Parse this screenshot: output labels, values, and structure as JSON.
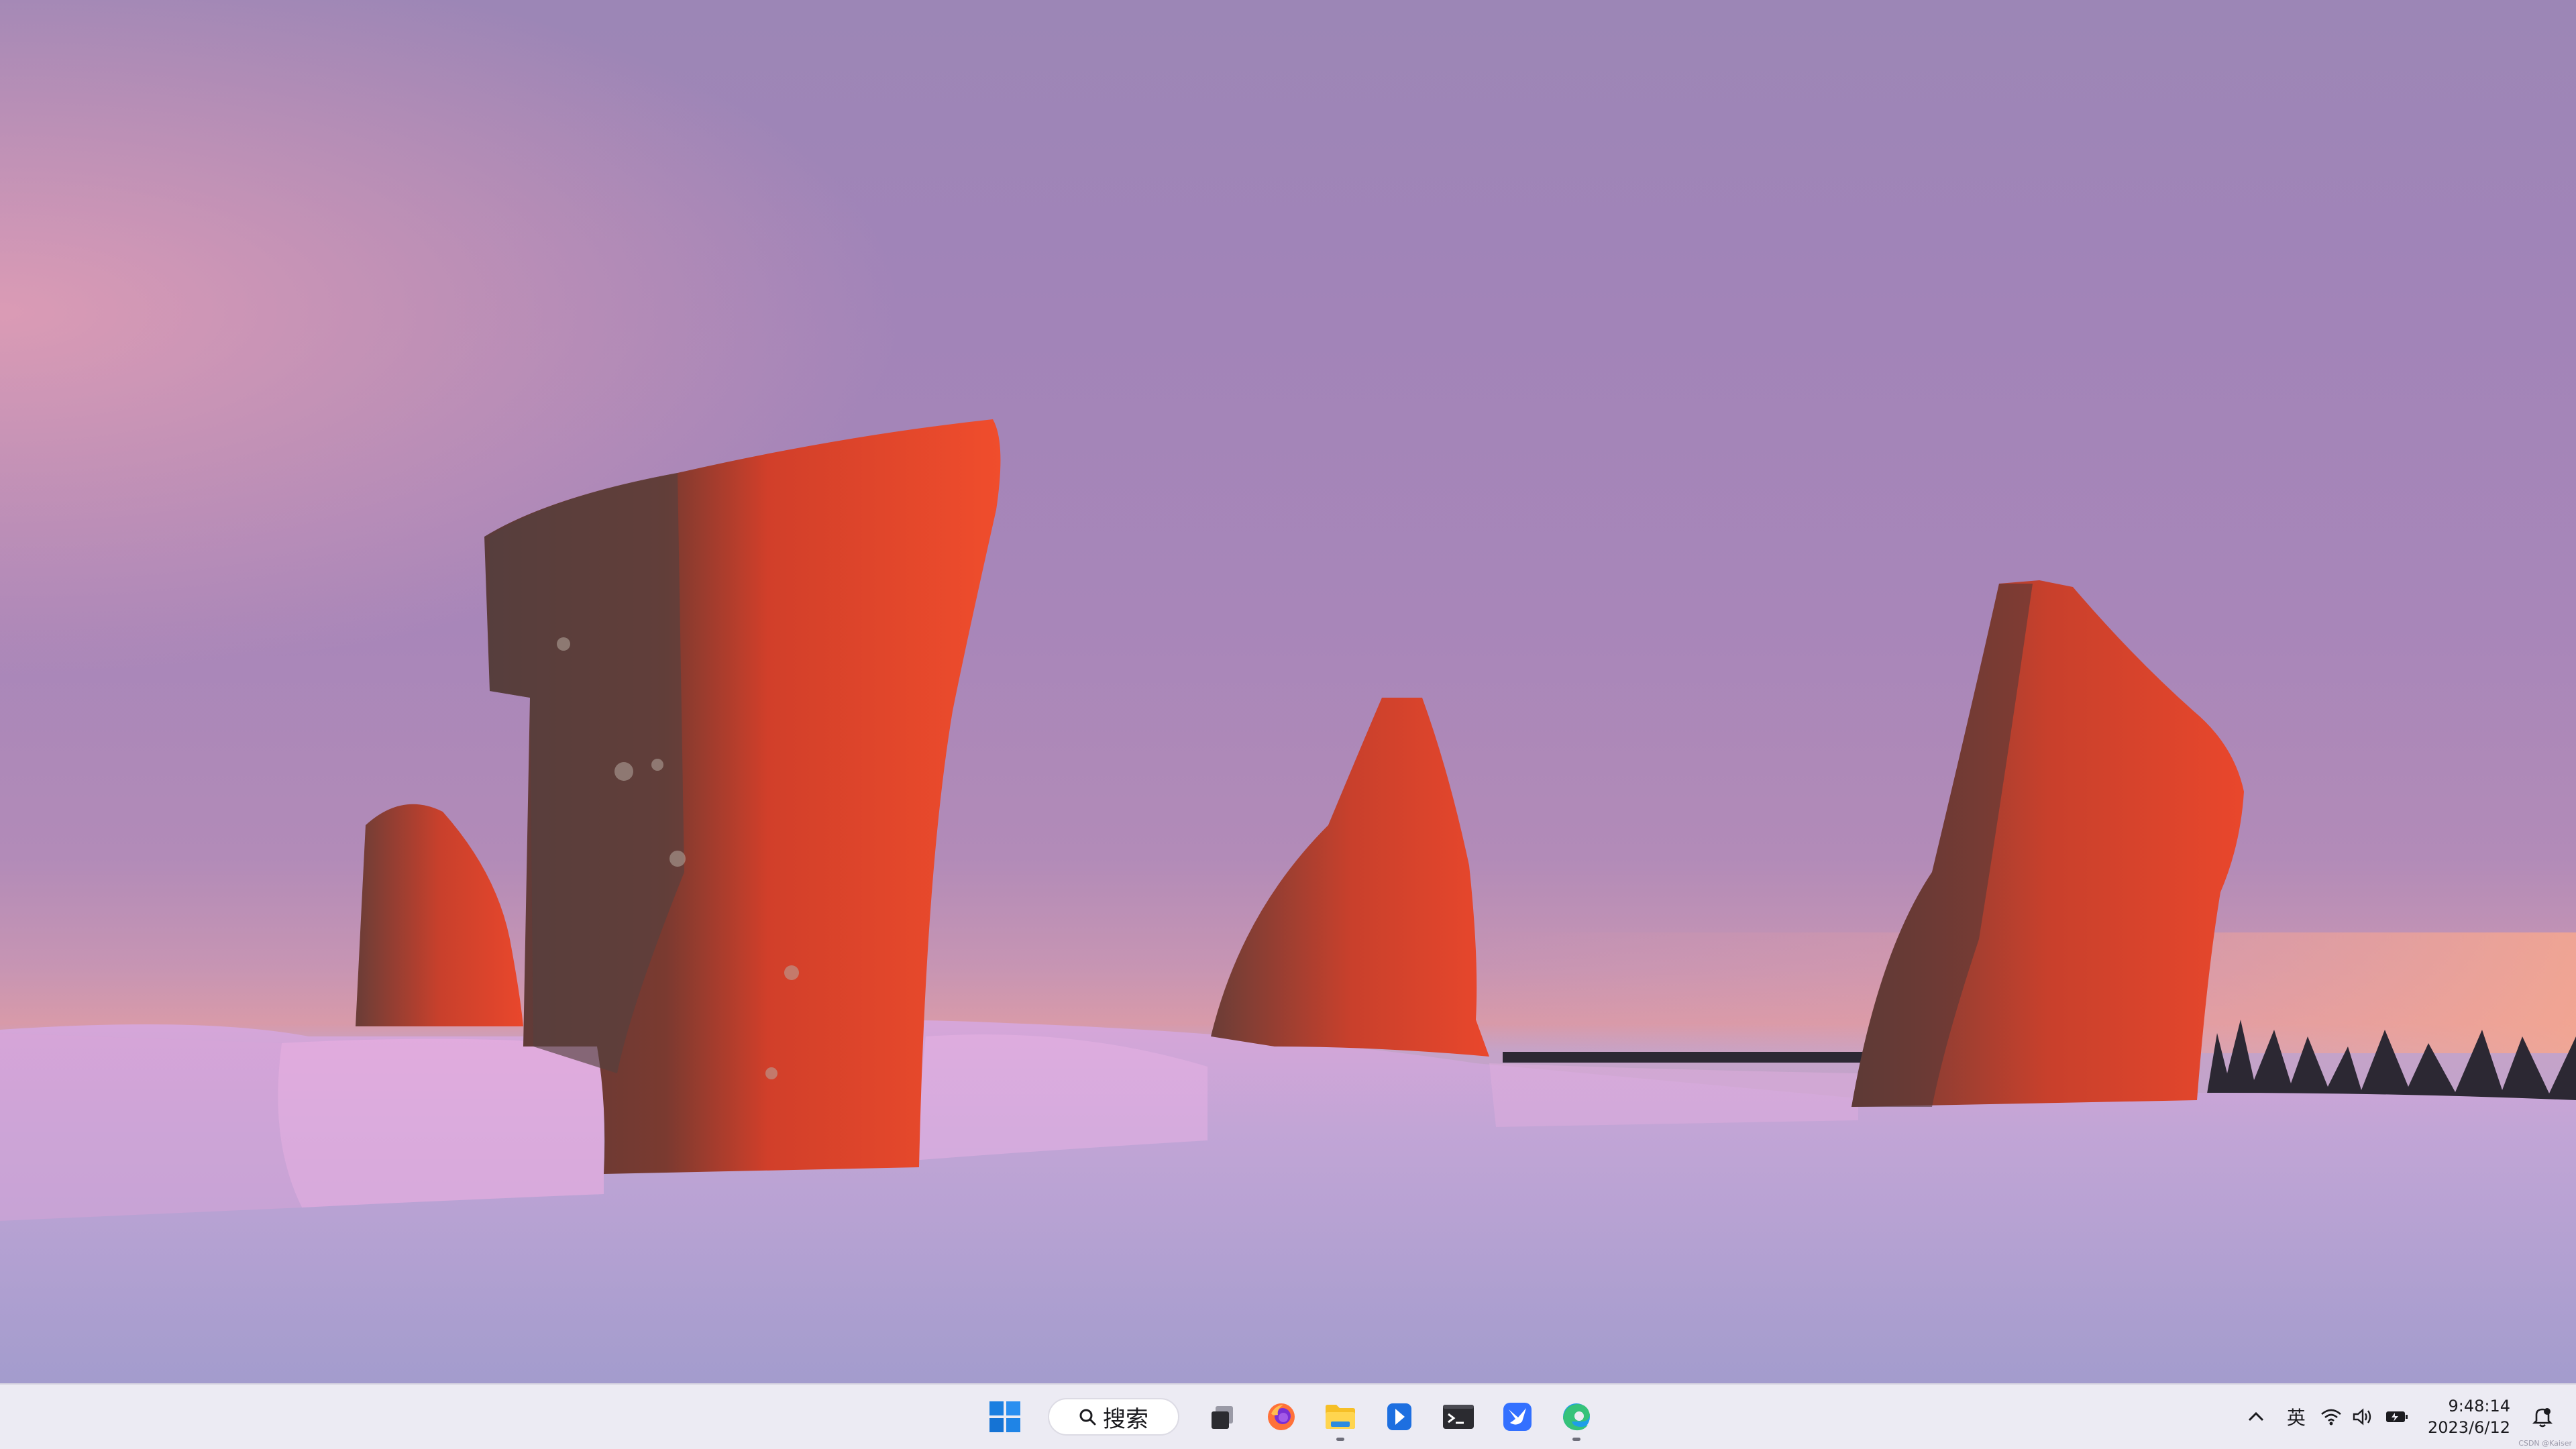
{
  "wallpaper": {
    "sky_color": "#a184b8",
    "horizon_glow": "#e6a0a0",
    "snow_color": "#b9a4cf",
    "rock_lit_color": "#e0442c",
    "rock_dark_color": "#5b3a39"
  },
  "taskbar": {
    "start_icon": "windows-start-icon",
    "search": {
      "label": "搜索",
      "icon": "search-icon"
    },
    "apps": [
      {
        "name": "task-view",
        "icon": "task-view-icon"
      },
      {
        "name": "firefox",
        "icon": "firefox-icon"
      },
      {
        "name": "file-explorer",
        "icon": "folder-icon",
        "running": true
      },
      {
        "name": "app-blue",
        "icon": "bookmark-app-icon"
      },
      {
        "name": "terminal",
        "icon": "terminal-icon"
      },
      {
        "name": "feishu",
        "icon": "bird-app-icon"
      },
      {
        "name": "edge",
        "icon": "edge-icon",
        "running": true
      }
    ],
    "tray": {
      "chevron": "^",
      "ime": "英",
      "wifi_icon": "wifi-icon",
      "volume_icon": "volume-icon",
      "battery_icon": "battery-icon"
    },
    "clock": {
      "time": "9:48:14",
      "date": "2023/6/12"
    },
    "notification_icon": "notification-bell-icon",
    "watermark": "CSDN @Kaiser"
  }
}
